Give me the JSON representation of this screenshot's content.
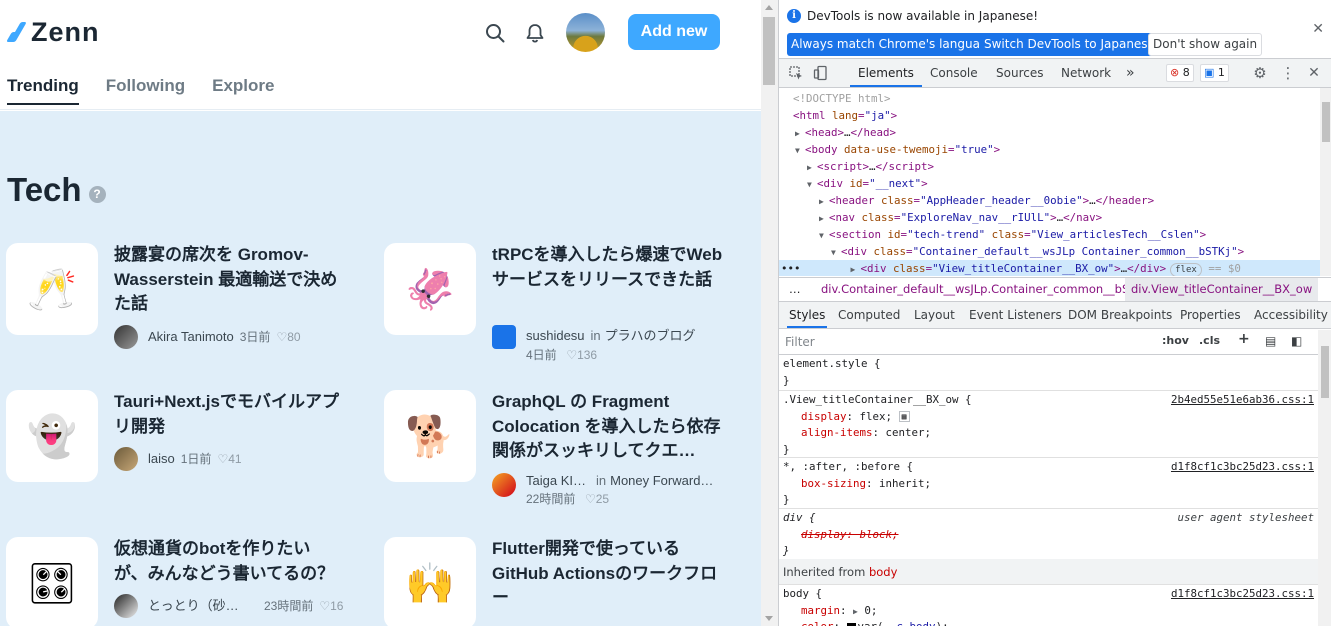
{
  "zenn": {
    "logo": "Zenn",
    "add_new": "Add new",
    "tabs": [
      "Trending",
      "Following",
      "Explore"
    ],
    "section_title": "Tech",
    "help": "?",
    "articles": [
      {
        "emoji": "🥂",
        "title": "披露宴の席次を Gromov-Wasserstein 最適輸送で決めた話",
        "author": "Akira Tanimoto",
        "time": "3日前",
        "likes": "80"
      },
      {
        "emoji": "🦑",
        "title": "tRPCを導入したら爆速でWebサービスをリリースできた話",
        "author": "sushidesu",
        "publication_prefix": "in",
        "publication": "プラハのブログ",
        "time": "4日前",
        "likes": "136"
      },
      {
        "emoji": "👻",
        "title": "Tauri+Next.jsでモバイルアプリ開発",
        "author": "laiso",
        "time": "1日前",
        "likes": "41"
      },
      {
        "emoji": "🐕",
        "title": "GraphQL の Fragment Colocation を導入したら依存関係がスッキリしてクエ…",
        "author": "Taiga KI…",
        "publication_prefix": "in",
        "publication": "Money Forward…",
        "time": "22時間前",
        "likes": "25"
      },
      {
        "emoji": "🎛",
        "title": "仮想通貨のbotを作りたいが、みんなどう書いてるの？",
        "author": "とっとり（砂…",
        "time": "23時間前",
        "likes": "16"
      },
      {
        "emoji": "🙌",
        "title": "Flutter開発で使っているGitHub Actionsのワークフロー",
        "author": "",
        "time": "",
        "likes": ""
      }
    ]
  },
  "devtools": {
    "info_text": "DevTools is now available in Japanese!",
    "btn_match": "Always match Chrome's language",
    "btn_switch": "Switch DevTools to Japanese",
    "btn_dont": "Don't show again",
    "tabs": [
      "Elements",
      "Console",
      "Sources",
      "Network"
    ],
    "more_tabs": "»",
    "errors": "8",
    "messages": "1",
    "breadcrumbs": [
      "div.Container_default__wsJLp.Container_common__bSTKj",
      "div.View_titleContainer__BX_ow"
    ],
    "breadcrumbs_more": "…",
    "style_tabs": [
      "Styles",
      "Computed",
      "Layout",
      "Event Listeners",
      "DOM Breakpoints",
      "Properties",
      "Accessibility"
    ],
    "filter_placeholder": "Filter",
    "hov": ":hov",
    "cls": ".cls",
    "inherited_from": "Inherited from",
    "inherited_tag": "body"
  }
}
